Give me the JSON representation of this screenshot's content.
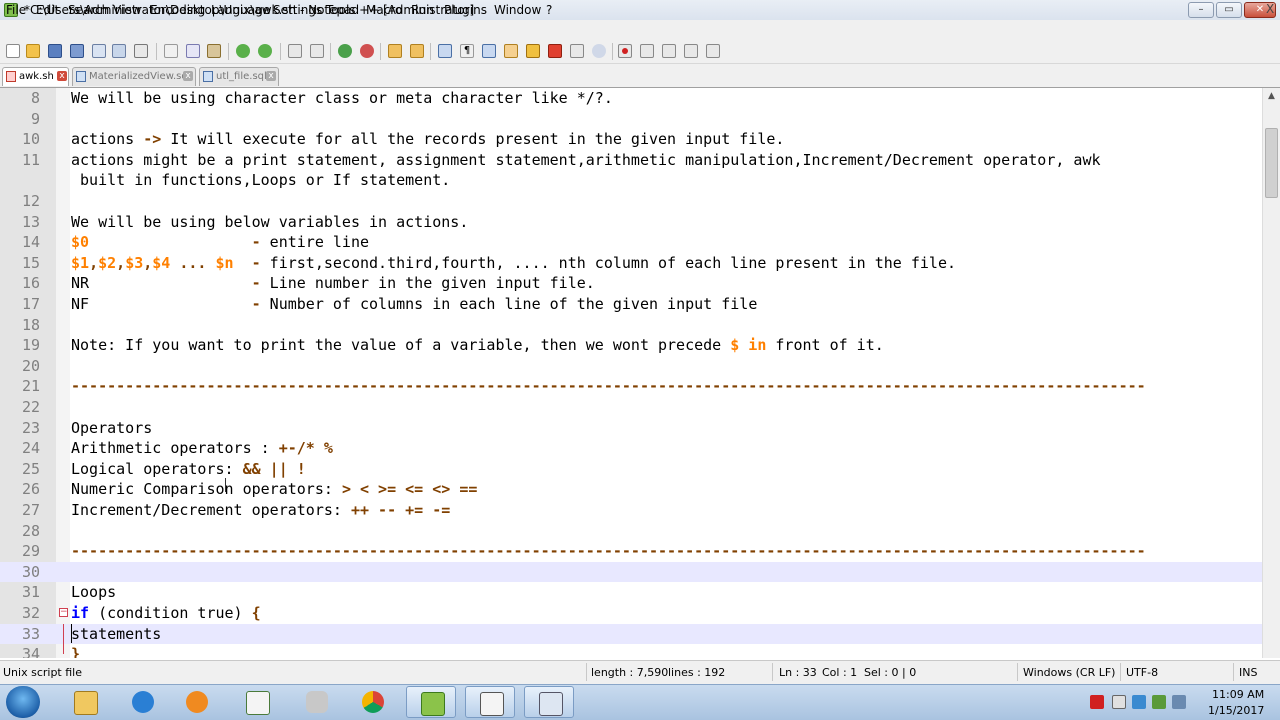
{
  "window": {
    "title": "*C:\\Users\\Administrator\\Desktop\\Unix\\awk.sh - Notepad++ [Administrator]",
    "controls": {
      "minimize": "–",
      "maximize": "▭",
      "close": "✕"
    }
  },
  "menu": {
    "items": [
      "File",
      "Edit",
      "Search",
      "View",
      "Encoding",
      "Language",
      "Settings",
      "Tools",
      "Macro",
      "Run",
      "Plugins",
      "Window",
      "?"
    ],
    "close_doc": "X"
  },
  "toolbar": {
    "icons": [
      "new-file-icon",
      "open-file-icon",
      "save-icon",
      "save-all-icon",
      "close-icon",
      "close-all-icon",
      "print-icon",
      "cut-icon",
      "copy-icon",
      "paste-icon",
      "undo-icon",
      "redo-icon",
      "find-icon",
      "replace-icon",
      "zoom-in-icon",
      "zoom-out-icon",
      "sync-v-icon",
      "sync-h-icon",
      "word-wrap-icon",
      "show-all-chars-icon",
      "indent-guide-icon",
      "udl-icon",
      "doc-map-icon",
      "function-list-icon",
      "folder-as-workspace-icon",
      "monitoring-icon",
      "record-macro-icon",
      "stop-macro-icon",
      "play-macro-icon",
      "run-macro-multiple-icon",
      "save-macro-icon"
    ]
  },
  "tabs": [
    {
      "label": "awk.sh",
      "close": "x"
    },
    {
      "label": "MaterializedView.sql",
      "close": "x"
    },
    {
      "label": "utl_file.sql",
      "close": "x"
    }
  ],
  "editor": {
    "lines": [
      {
        "n": "8",
        "segs": [
          {
            "t": "We will be using character class or meta character like */?.",
            "c": "p"
          }
        ]
      },
      {
        "n": "9",
        "segs": []
      },
      {
        "n": "10",
        "segs": [
          {
            "t": "actions ",
            "c": "p"
          },
          {
            "t": "->",
            "c": "op"
          },
          {
            "t": " It will execute for all the records present in the given input file.",
            "c": "p"
          }
        ]
      },
      {
        "n": "11",
        "segs": [
          {
            "t": "actions might be a print statement, assignment statement,arithmetic manipulation,Increment/Decrement operator, awk",
            "c": "p"
          }
        ]
      },
      {
        "n": "",
        "segs": [
          {
            "t": " built in functions,Loops or If statement.",
            "c": "p"
          }
        ]
      },
      {
        "n": "12",
        "segs": []
      },
      {
        "n": "13",
        "segs": [
          {
            "t": "We will be using below variables in actions.",
            "c": "p"
          }
        ]
      },
      {
        "n": "14",
        "segs": [
          {
            "t": "$0",
            "c": "var"
          },
          {
            "t": "                  ",
            "c": "p"
          },
          {
            "t": "-",
            "c": "op"
          },
          {
            "t": " entire line",
            "c": "p"
          }
        ]
      },
      {
        "n": "15",
        "segs": [
          {
            "t": "$1",
            "c": "var"
          },
          {
            "t": ",",
            "c": "op"
          },
          {
            "t": "$2",
            "c": "var"
          },
          {
            "t": ",",
            "c": "op"
          },
          {
            "t": "$3",
            "c": "var"
          },
          {
            "t": ",",
            "c": "op"
          },
          {
            "t": "$4",
            "c": "var"
          },
          {
            "t": " ... ",
            "c": "op"
          },
          {
            "t": "$n",
            "c": "var"
          },
          {
            "t": "  ",
            "c": "p"
          },
          {
            "t": "-",
            "c": "op"
          },
          {
            "t": " first,second.third,fourth, .... nth column of each line present in the file.",
            "c": "p"
          }
        ]
      },
      {
        "n": "16",
        "segs": [
          {
            "t": "NR                  ",
            "c": "p"
          },
          {
            "t": "-",
            "c": "op"
          },
          {
            "t": " Line number in the given input file.",
            "c": "p"
          }
        ]
      },
      {
        "n": "17",
        "segs": [
          {
            "t": "NF                  ",
            "c": "p"
          },
          {
            "t": "-",
            "c": "op"
          },
          {
            "t": " Number of columns in each line of the given input file",
            "c": "p"
          }
        ]
      },
      {
        "n": "18",
        "segs": []
      },
      {
        "n": "19",
        "segs": [
          {
            "t": "Note: If you want to print the value of a variable, then we wont precede ",
            "c": "p"
          },
          {
            "t": "$ in",
            "c": "var"
          },
          {
            "t": " front of it.",
            "c": "p"
          }
        ]
      },
      {
        "n": "20",
        "segs": []
      },
      {
        "n": "21",
        "segs": [
          {
            "t": "-----------------------------------------------------------------------------------------------------------------------",
            "c": "sep"
          }
        ]
      },
      {
        "n": "22",
        "segs": []
      },
      {
        "n": "23",
        "segs": [
          {
            "t": "Operators",
            "c": "p"
          }
        ]
      },
      {
        "n": "24",
        "segs": [
          {
            "t": "Arithmetic operators : ",
            "c": "p"
          },
          {
            "t": "+-/* %",
            "c": "op"
          }
        ]
      },
      {
        "n": "25",
        "segs": [
          {
            "t": "Logical operators: ",
            "c": "p"
          },
          {
            "t": "&& || !",
            "c": "op"
          }
        ]
      },
      {
        "n": "26",
        "segs": [
          {
            "t": "Numeric Comparison operators: ",
            "c": "p"
          },
          {
            "t": "> < >= <= <> ==",
            "c": "op"
          }
        ]
      },
      {
        "n": "27",
        "segs": [
          {
            "t": "Increment/Decrement operators: ",
            "c": "p"
          },
          {
            "t": "++ -- += -=",
            "c": "op"
          }
        ]
      },
      {
        "n": "28",
        "segs": []
      },
      {
        "n": "29",
        "segs": [
          {
            "t": "-----------------------------------------------------------------------------------------------------------------------",
            "c": "sep"
          }
        ]
      },
      {
        "n": "30",
        "segs": []
      },
      {
        "n": "31",
        "segs": [
          {
            "t": "Loops",
            "c": "p"
          }
        ]
      },
      {
        "n": "32",
        "segs": [
          {
            "t": "if",
            "c": "kw"
          },
          {
            "t": " (condition true) ",
            "c": "p"
          },
          {
            "t": "{",
            "c": "op"
          }
        ]
      },
      {
        "n": "33",
        "segs": [
          {
            "t": "statements",
            "c": "p"
          }
        ]
      },
      {
        "n": "34",
        "segs": [
          {
            "t": "}",
            "c": "op"
          }
        ]
      }
    ]
  },
  "status": {
    "file_type": "Unix script file",
    "length": "length : 7,590",
    "lines": "lines : 192",
    "ln": "Ln : 33",
    "col": "Col : 1",
    "sel": "Sel : 0 | 0",
    "eol": "Windows (CR LF)",
    "encoding": "UTF-8",
    "mode": "INS"
  },
  "taskbar": {
    "apps": [
      "explorer-icon",
      "internet-explorer-icon",
      "media-player-icon",
      "notepad-icon",
      "sql-icon",
      "chrome-icon",
      "notepadpp-icon",
      "task-icon",
      "window-icon"
    ],
    "clock_time": "11:09 AM",
    "clock_date": "1/15/2017"
  },
  "colors": {
    "operator": "#804000",
    "variable": "#ff8000",
    "keyword": "#0000ff",
    "line_number": "#808080",
    "current_line": "#e8e8ff"
  }
}
